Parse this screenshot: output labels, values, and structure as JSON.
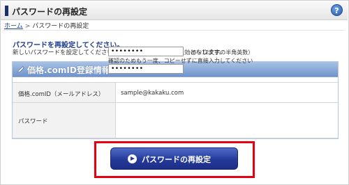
{
  "header": {
    "title": "パスワードの再設定",
    "help_icon": "help-icon",
    "help_glyph": "?"
  },
  "breadcrumb": {
    "home": "ホーム",
    "separator": ">",
    "current": "パスワードの再設定"
  },
  "intro": {
    "heading": "パスワードを再設定してください。",
    "description": "新しいパスワードを設定してください。今までのパスワードは無効となります。"
  },
  "panel": {
    "title": "価格.comID登録情報",
    "icon": "pencil-icon",
    "rows": {
      "id": {
        "label": "価格.comID（メールアドレス）",
        "value": "sample@kakaku.com"
      },
      "password": {
        "label": "パスワード",
        "value": "••••••••",
        "hint": "（8～12文字の半角英数）",
        "confirm_note": "確認のためもう一度、コピーせずに直接入力してください",
        "confirm_value": "••••••••"
      }
    }
  },
  "submit": {
    "label": "パスワードの再設定",
    "icon": "play-icon"
  },
  "colors": {
    "accent": "#1c2f6b",
    "button": "#24399a",
    "highlight": "#e60012",
    "link": "#1a3e9c"
  }
}
